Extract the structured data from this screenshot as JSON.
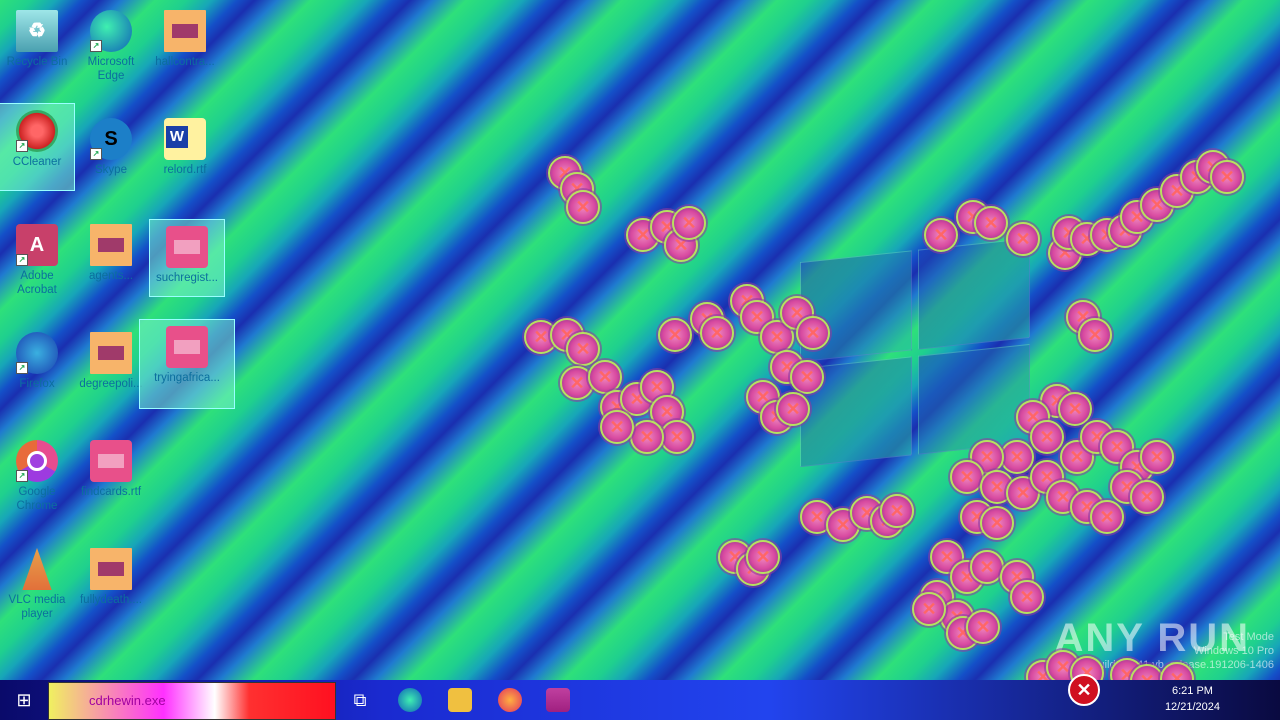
{
  "desktop": {
    "icons": [
      {
        "label": "Recycle Bin",
        "icon": "recycle-bin-icon"
      },
      {
        "label": "Microsoft Edge",
        "icon": "edge-icon"
      },
      {
        "label": "hallcontra...",
        "icon": "image-file-icon"
      },
      {
        "label": "CCleaner",
        "icon": "ccleaner-icon"
      },
      {
        "label": "Skype",
        "icon": "skype-icon"
      },
      {
        "label": "relord.rtf",
        "icon": "word-doc-icon"
      },
      {
        "label": "Adobe Acrobat",
        "icon": "acrobat-icon"
      },
      {
        "label": "agents...",
        "icon": "image-file-icon"
      },
      {
        "label": "suchregist...",
        "icon": "image-file-icon"
      },
      {
        "label": "Firefox",
        "icon": "firefox-icon"
      },
      {
        "label": "degreepoli...",
        "icon": "image-file-icon"
      },
      {
        "label": "tryingafrica...",
        "icon": "word-doc-icon"
      },
      {
        "label": "Google Chrome",
        "icon": "chrome-icon"
      },
      {
        "label": "findcards.rtf",
        "icon": "word-doc-icon"
      },
      {
        "label": "VLC media player",
        "icon": "vlc-icon"
      },
      {
        "label": "fullydeath....",
        "icon": "image-file-icon"
      }
    ]
  },
  "taskbar": {
    "search_text": "cdrhewin.exe",
    "clock_time": "6:21 PM",
    "clock_date": "12/21/2024"
  },
  "watermark": {
    "text": "ANY RUN",
    "os_info_1": "Test Mode",
    "os_info_2": "Windows 10 Pro",
    "os_info_3": "Build 19041.vb_release.191206-1406"
  },
  "colors": {
    "error_accent": "#d01020",
    "taskbar_bg": "#1a2ad0"
  }
}
